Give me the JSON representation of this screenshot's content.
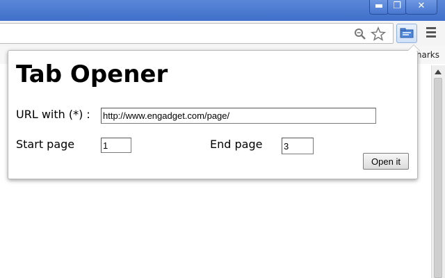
{
  "window": {
    "minimize_glyph": "▬",
    "restore_glyph": "❐",
    "close_glyph": "✕"
  },
  "toolbar": {
    "zoom_icon": "magnifier-icon",
    "star_icon": "bookmark-star-icon",
    "extension_icon": "tab-opener-extension-icon",
    "menu_icon": "hamburger-menu-icon"
  },
  "bookmarks_bar": {
    "visible_text": "narks"
  },
  "popup": {
    "title": "Tab Opener",
    "url_label": "URL with (*) :",
    "url_value": "http://www.engadget.com/page/",
    "start_label": "Start page",
    "start_value": "1",
    "end_label": "End page",
    "end_value": "3",
    "open_button": "Open it"
  },
  "colors": {
    "titlebar": "#3f6fc9",
    "focus_border": "#e1b55b"
  }
}
